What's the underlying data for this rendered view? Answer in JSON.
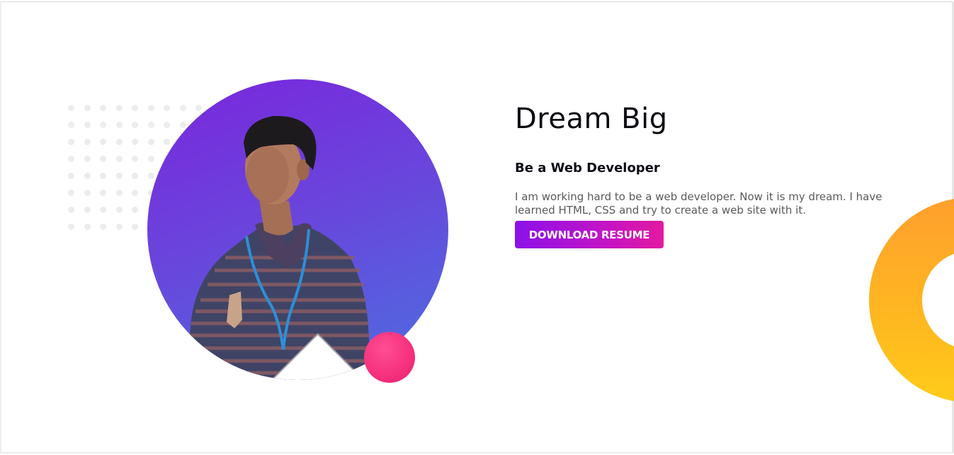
{
  "hero": {
    "title": "Dream Big",
    "subtitle": "Be a Web Developer",
    "text": "I am working hard to be a web developer. Now it is my dream. I have learned HTML, CSS and try to create a web site with it.",
    "button_label": "DOWNLOAD RESUME"
  },
  "colors": {
    "portrait_gradient_start": "#7a26dc",
    "portrait_gradient_end": "#4c6fe0",
    "button_gradient_start": "#8b12e8",
    "button_gradient_end": "#e21a9f",
    "accent_pink": "#f5307c",
    "accent_orange": "#ffb820"
  },
  "icons": {
    "portrait": "person-photo",
    "pattern": "dot-grid"
  }
}
